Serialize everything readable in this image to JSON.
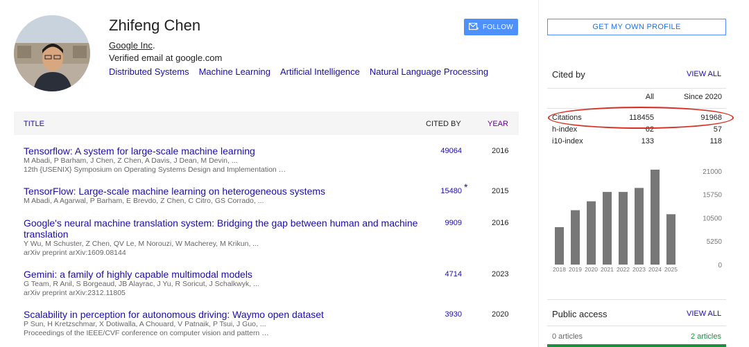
{
  "profile": {
    "name": "Zhifeng Chen",
    "affiliation": "Google Inc",
    "email": "Verified email at google.com",
    "interests": [
      "Distributed Systems",
      "Machine Learning",
      "Artificial Intelligence",
      "Natural Language Processing"
    ],
    "follow_label": "FOLLOW"
  },
  "table": {
    "headers": {
      "title": "TITLE",
      "cited_by": "CITED BY",
      "year": "YEAR"
    },
    "rows": [
      {
        "title": "Tensorflow: A system for large-scale machine learning",
        "authors": "M Abadi, P Barham, J Chen, Z Chen, A Davis, J Dean, M Devin, ...",
        "venue": "12th {USENIX} Symposium on Operating Systems Design and Implementation …",
        "cited_by": "49064",
        "year": "2016"
      },
      {
        "title": "TensorFlow: Large-scale machine learning on heterogeneous systems",
        "authors": "M Abadi, A Agarwal, P Barham, E Brevdo, Z Chen, C Citro, GS Corrado, ...",
        "venue": "",
        "cited_by": "15480",
        "star": "*",
        "year": "2015"
      },
      {
        "title": "Google's neural machine translation system: Bridging the gap between human and machine translation",
        "authors": "Y Wu, M Schuster, Z Chen, QV Le, M Norouzi, W Macherey, M Krikun, ...",
        "venue": "arXiv preprint arXiv:1609.08144",
        "cited_by": "9909",
        "year": "2016"
      },
      {
        "title": "Gemini: a family of highly capable multimodal models",
        "authors": "G Team, R Anil, S Borgeaud, JB Alayrac, J Yu, R Soricut, J Schalkwyk, ...",
        "venue": "arXiv preprint arXiv:2312.11805",
        "cited_by": "4714",
        "year": "2023"
      },
      {
        "title": "Scalability in perception for autonomous driving: Waymo open dataset",
        "authors": "P Sun, H Kretzschmar, X Dotiwalla, A Chouard, V Patnaik, P Tsui, J Guo, ...",
        "venue": "Proceedings of the IEEE/CVF conference on computer vision and pattern …",
        "cited_by": "3930",
        "year": "2020"
      }
    ]
  },
  "sidebar": {
    "get_profile": "GET MY OWN PROFILE",
    "cited_by": {
      "title": "Cited by",
      "view_all": "VIEW ALL",
      "col_all": "All",
      "col_since": "Since 2020",
      "rows": [
        {
          "label": "Citations",
          "all": "118455",
          "since": "91968"
        },
        {
          "label": "h-index",
          "all": "62",
          "since": "57"
        },
        {
          "label": "i10-index",
          "all": "133",
          "since": "118"
        }
      ]
    },
    "public_access": {
      "title": "Public access",
      "view_all": "VIEW ALL",
      "left": "0 articles",
      "right": "2 articles"
    }
  },
  "colors": {
    "link": "#1a0dab",
    "bar": "#777777",
    "follow": "#4d90fe",
    "highlight": "#d93025",
    "public": "#1e8e3e"
  },
  "chart_data": {
    "type": "bar",
    "categories": [
      "2018",
      "2019",
      "2020",
      "2021",
      "2022",
      "2023",
      "2024",
      "2025"
    ],
    "values": [
      8400,
      12200,
      14200,
      16300,
      16300,
      17200,
      21300,
      11300
    ],
    "yticks": [
      0,
      5250,
      10500,
      15750,
      21000
    ],
    "ylim": [
      0,
      23000
    ],
    "grid": false
  }
}
